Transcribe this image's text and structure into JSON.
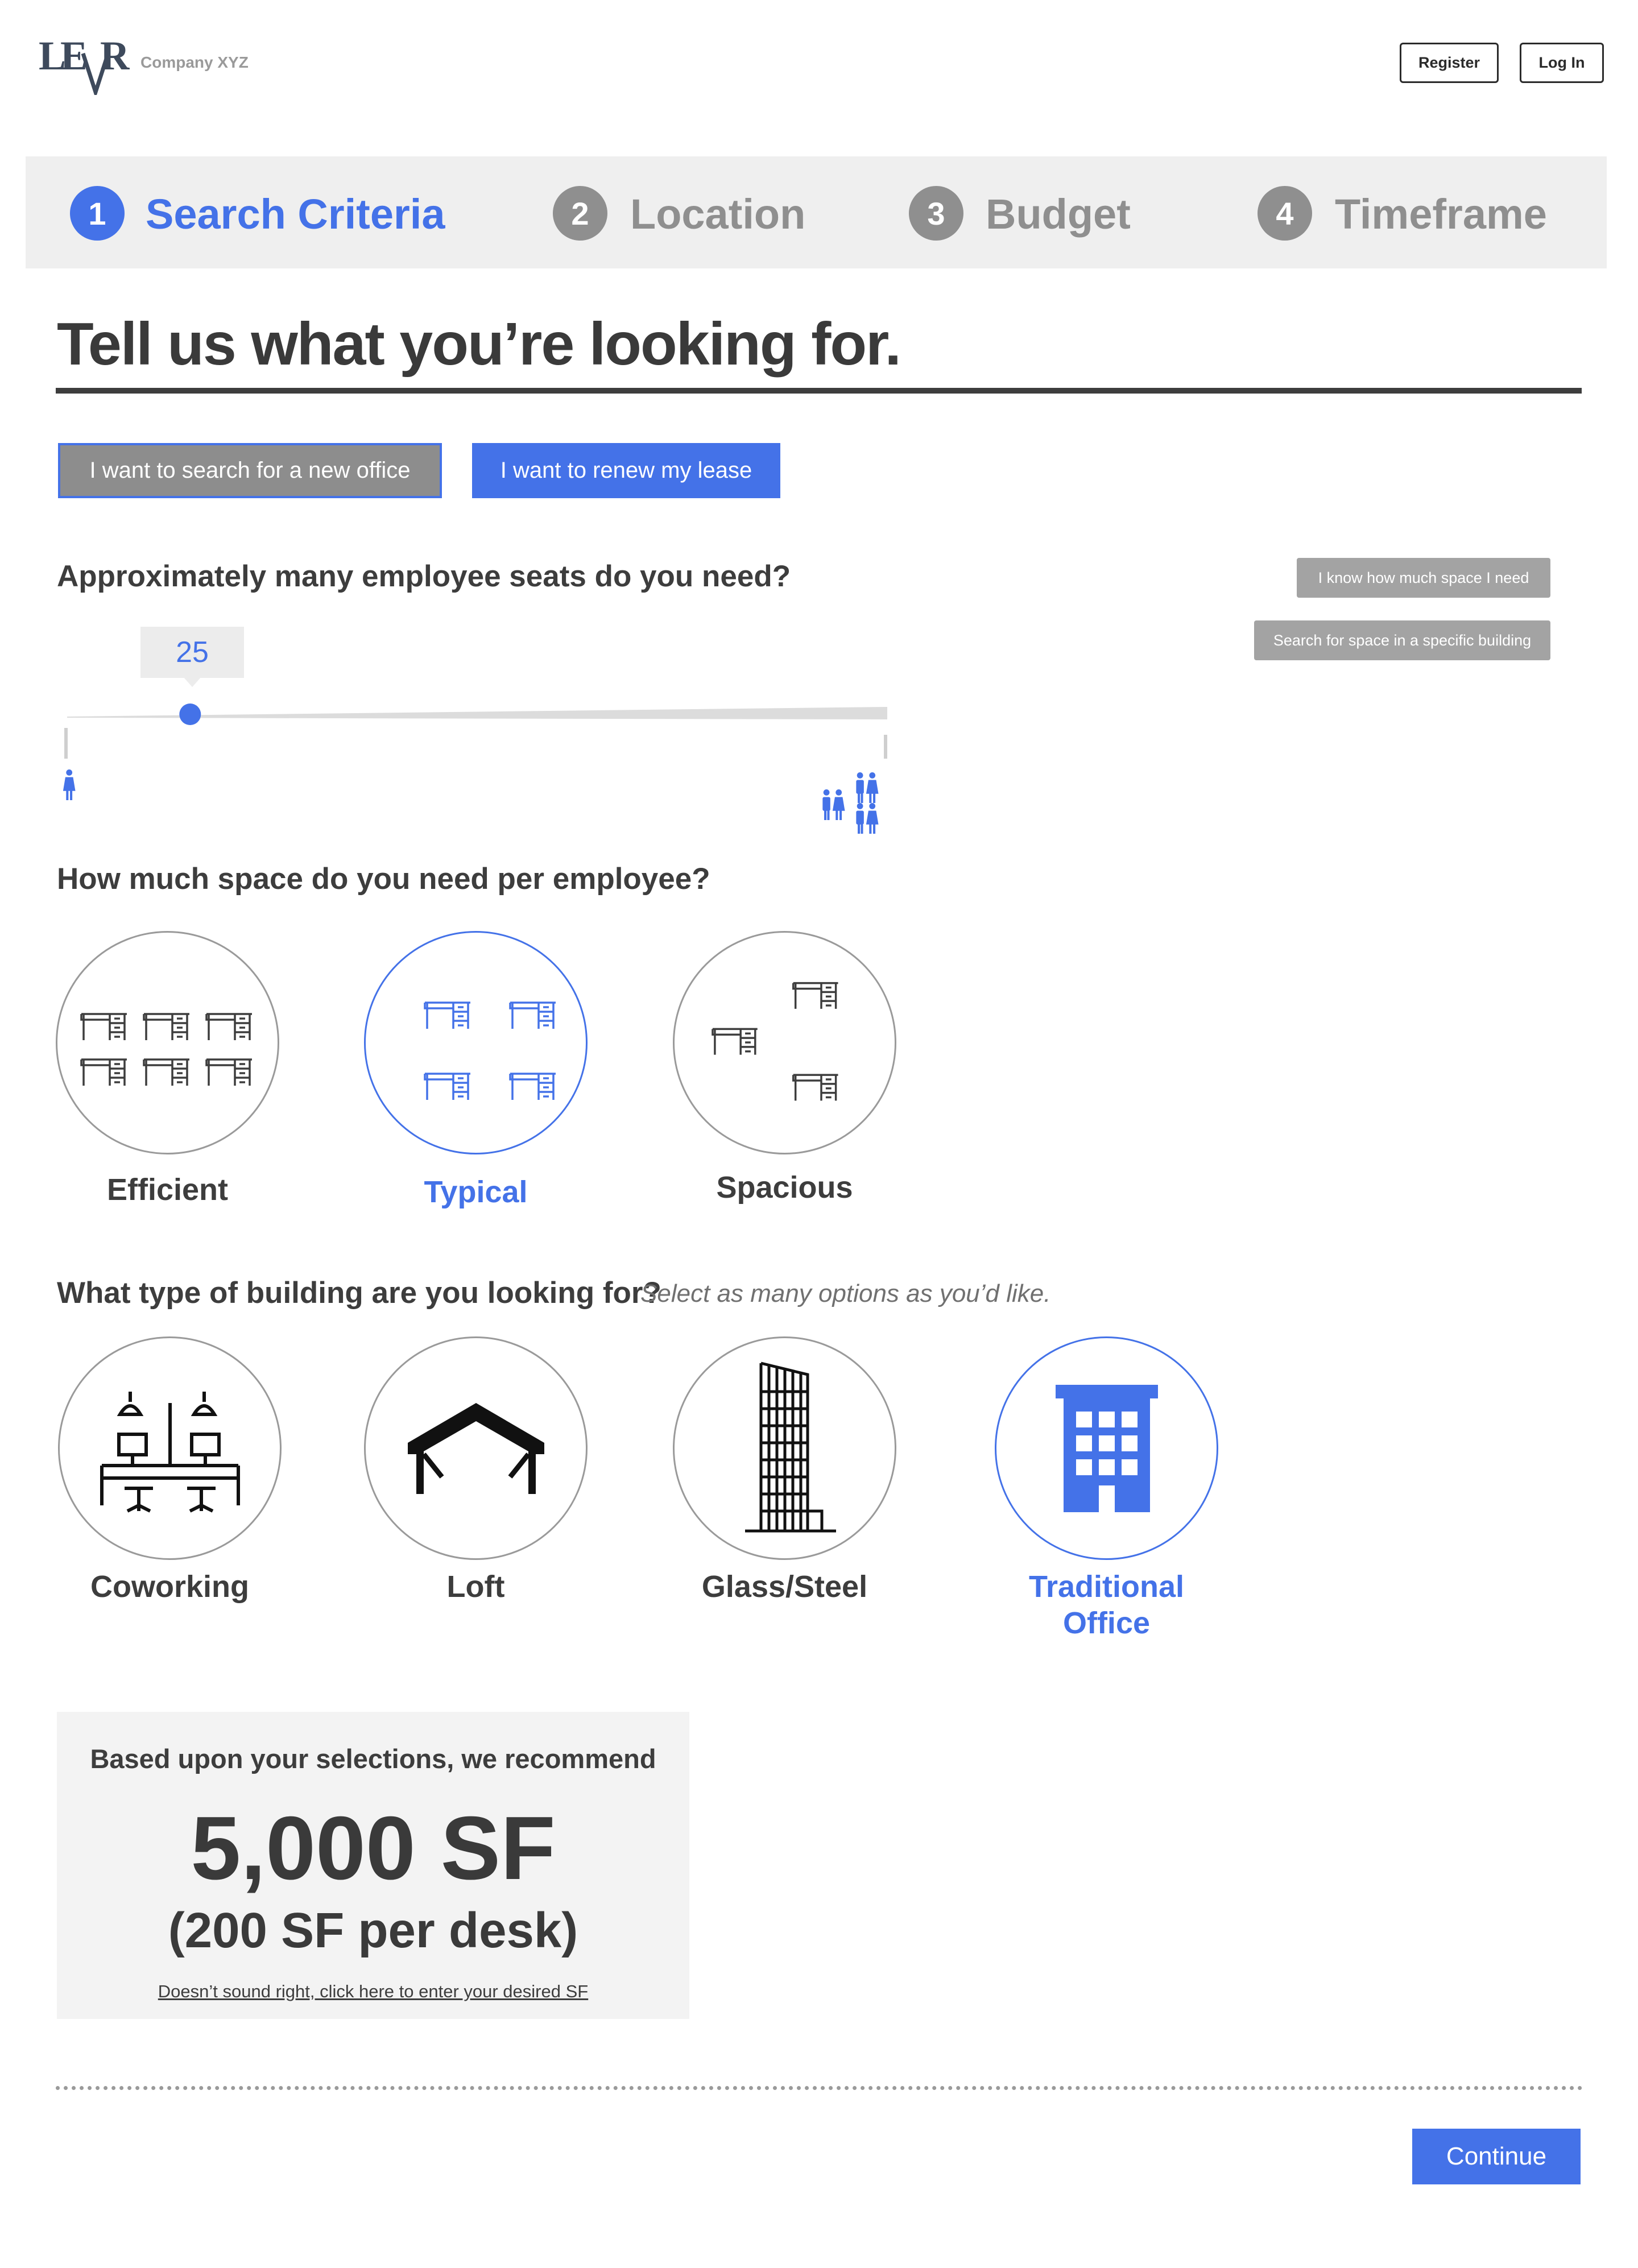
{
  "header": {
    "logo_text": "LEVR",
    "company": "Company XYZ",
    "register_label": "Register",
    "login_label": "Log In"
  },
  "steps": [
    {
      "num": "1",
      "label": "Search Criteria",
      "active": true
    },
    {
      "num": "2",
      "label": "Location",
      "active": false
    },
    {
      "num": "3",
      "label": "Budget",
      "active": false
    },
    {
      "num": "4",
      "label": "Timeframe",
      "active": false
    }
  ],
  "headline": "Tell us what you’re looking for.",
  "intent": {
    "new_office_label": "I want to search for a new office",
    "renew_label": "I want to renew my lease",
    "selected": "new_office"
  },
  "seats": {
    "question": "Approximately many employee seats do you need?",
    "value": "25",
    "slider_fraction": 0.15,
    "know_space_label": "I know how much space I need",
    "specific_building_label": "Search for space in a specific building"
  },
  "space": {
    "question": "How much space do you need per employee?",
    "options": [
      {
        "label": "Efficient",
        "selected": false
      },
      {
        "label": "Typical",
        "selected": true
      },
      {
        "label": "Spacious",
        "selected": false
      }
    ]
  },
  "building": {
    "question": "What type of building are you looking for?",
    "hint": "Select as many options as you’d like.",
    "options": [
      {
        "label": "Coworking",
        "selected": false
      },
      {
        "label": "Loft",
        "selected": false
      },
      {
        "label": "Glass/Steel",
        "selected": false
      },
      {
        "label": "Traditional Office",
        "selected": true
      }
    ]
  },
  "recommendation": {
    "title": "Based upon your selections, we recommend",
    "amount": "5,000 SF",
    "per_desk": "(200 SF per desk)",
    "link": "Doesn’t sound right, click here to enter your desired SF"
  },
  "continue_label": "Continue",
  "colors": {
    "accent": "#4472e8",
    "inactive": "#8f8f8f",
    "text": "#3d3d3d",
    "panel": "#f3f3f3"
  }
}
